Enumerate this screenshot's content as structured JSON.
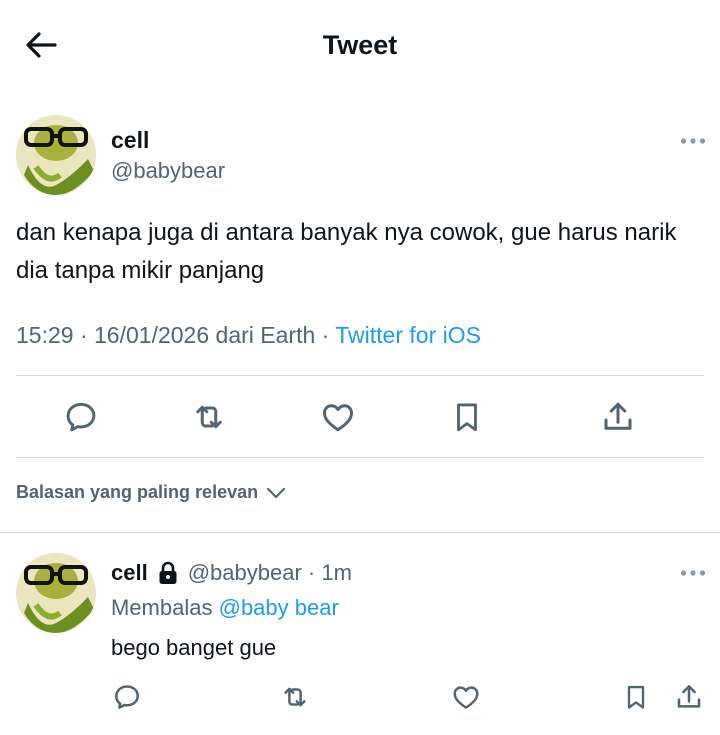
{
  "header": {
    "title": "Tweet"
  },
  "tweet": {
    "name": "cell",
    "handle": "@babybear",
    "text": "dan kenapa juga di antara banyak nya cowok, gue harus narik dia tanpa mikir panjang",
    "time": "15:29",
    "date": "16/01/2026",
    "location": "dari Earth",
    "source": "Twitter for iOS"
  },
  "sort": {
    "label": "Balasan yang paling relevan"
  },
  "reply": {
    "name": "cell",
    "handle": "@babybear",
    "age": "1m",
    "replying_label": "Membalas",
    "replying_to": "@baby bear",
    "text": "bego banget gue"
  },
  "colors": {
    "link": "#1d9bf0",
    "muted": "#536471",
    "divider": "#cfd9de"
  },
  "icons": [
    "back-arrow-icon",
    "more-icon",
    "reply-icon",
    "retweet-icon",
    "like-icon",
    "bookmark-icon",
    "share-icon",
    "chevron-down-icon",
    "lock-icon"
  ]
}
